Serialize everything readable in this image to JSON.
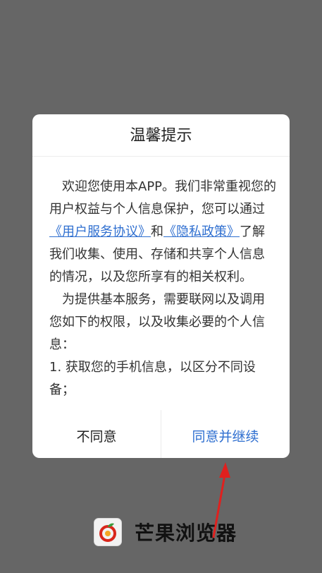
{
  "dialog": {
    "title": "温馨提示",
    "para1_before": "欢迎您使用本APP。我们非常重视您的用户权益与个人信息保护，您可以通过",
    "user_agreement_link": "《用户服务协议》",
    "para1_and": "和",
    "privacy_link": "《隐私政策》",
    "para1_after": "了解我们收集、使用、存储和共享个人信息的情况，以及您所享有的相关权利。",
    "para2": "为提供基本服务，需要联网以及调用您如下的权限，以及收集必要的个人信息：",
    "para3": "1. 获取您的手机信息，以区分不同设备；",
    "disagree_label": "不同意",
    "agree_label": "同意并继续"
  },
  "brand": {
    "name": "芒果浏览器",
    "icon": "mango-browser-logo-icon"
  },
  "colors": {
    "overlay": "#666666",
    "link": "#2f6fd0",
    "arrow": "#e0201e"
  }
}
